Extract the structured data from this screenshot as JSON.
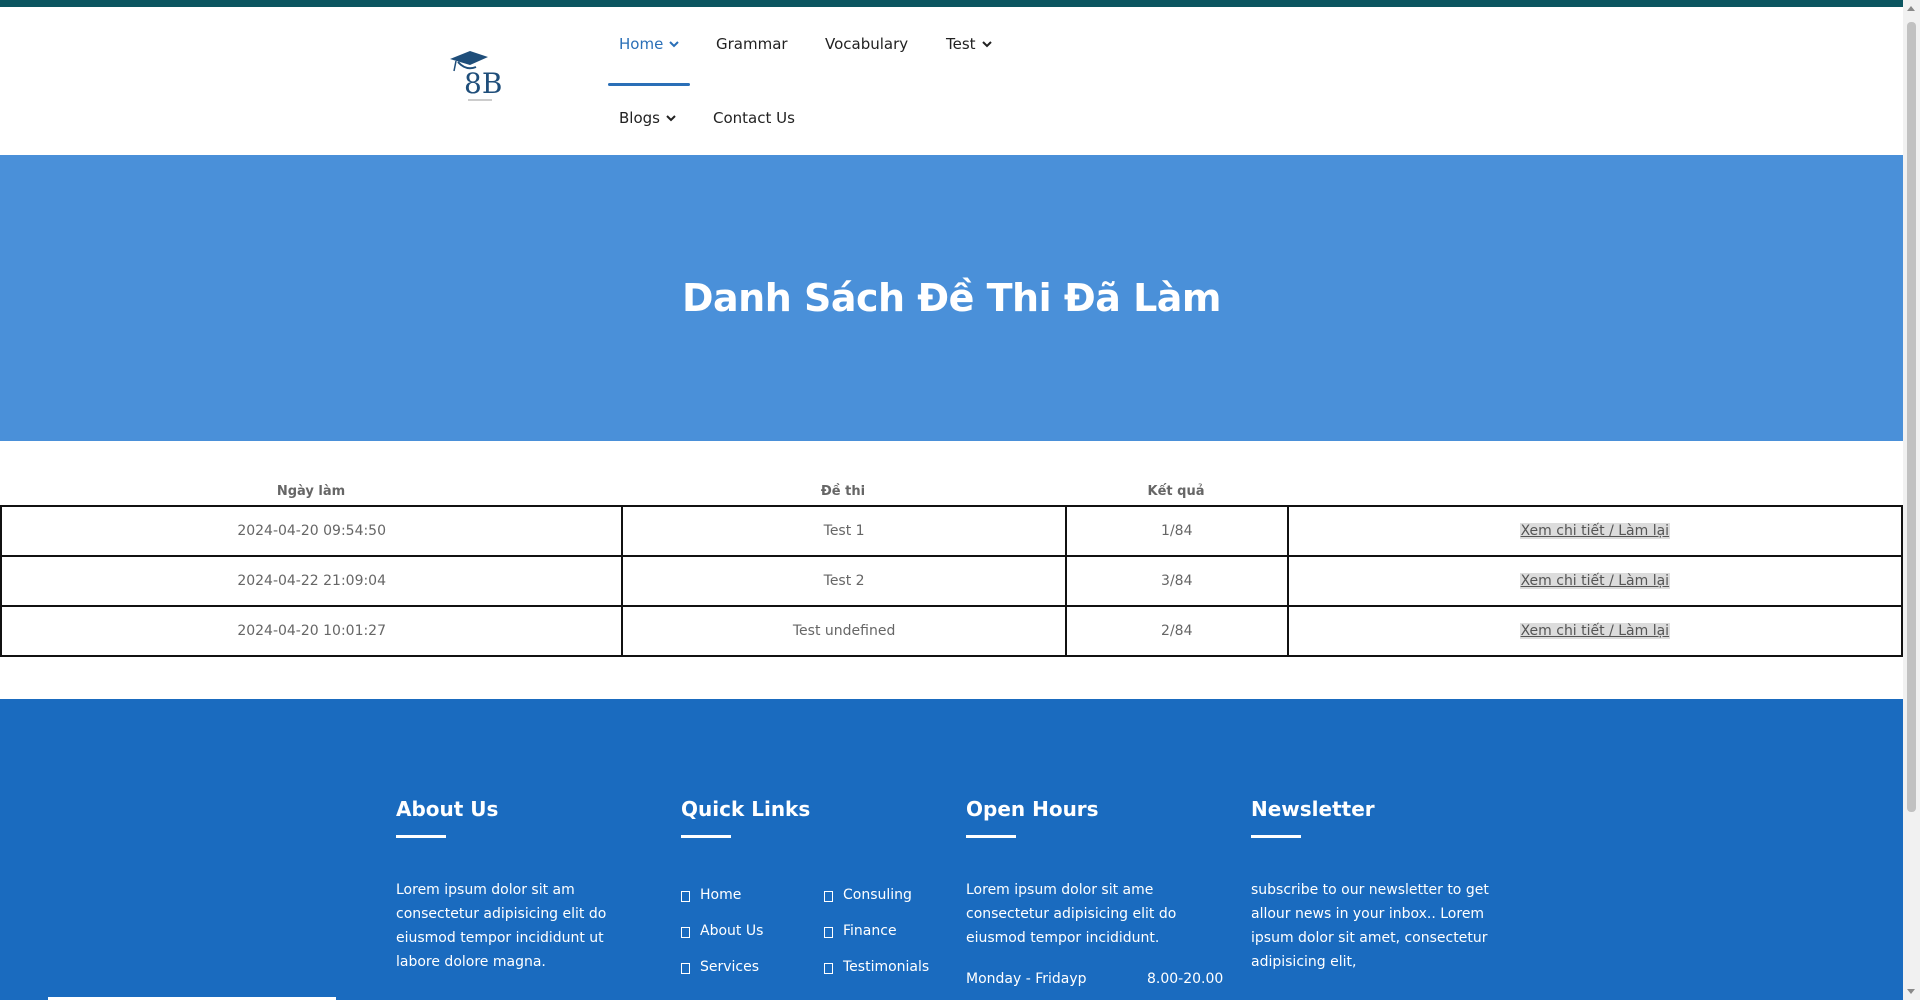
{
  "colors": {
    "top_strip": "#0b5560",
    "nav_active": "#2a6fb7",
    "hero_bg": "#4a90d9",
    "footer_bg": "#1a6bbf"
  },
  "logo": {
    "text": "8B",
    "icon": "graduation-cap-icon"
  },
  "nav": {
    "home": "Home",
    "grammar": "Grammar",
    "vocabulary": "Vocabulary",
    "test": "Test",
    "blogs": "Blogs",
    "contact": "Contact Us"
  },
  "hero": {
    "title": "Danh Sách Đề Thi Đã Làm"
  },
  "table": {
    "headers": [
      "Ngày làm",
      "Đề thi",
      "Kết quả"
    ],
    "rows": [
      {
        "date": "2024-04-20 09:54:50",
        "test": "Test 1",
        "score": "1/84",
        "action": "Xem chi tiết / Làm lại"
      },
      {
        "date": "2024-04-22 21:09:04",
        "test": "Test 2",
        "score": "3/84",
        "action": "Xem chi tiết / Làm lại"
      },
      {
        "date": "2024-04-20 10:01:27",
        "test": "Test undefined",
        "score": "2/84",
        "action": "Xem chi tiết / Làm lại"
      }
    ]
  },
  "footer": {
    "about": {
      "title": "About Us",
      "text": "Lorem ipsum dolor sit am consectetur adipisicing elit do eiusmod tempor incididunt ut labore dolore magna."
    },
    "quick_links": {
      "title": "Quick Links",
      "col1": [
        "Home",
        "About Us",
        "Services"
      ],
      "col2": [
        "Consuling",
        "Finance",
        "Testimonials"
      ]
    },
    "open_hours": {
      "title": "Open Hours",
      "text": "Lorem ipsum dolor sit ame consectetur adipisicing elit do eiusmod tempor incididunt.",
      "day": "Monday - Fridayp",
      "time": "8.00-20.00"
    },
    "newsletter": {
      "title": "Newsletter",
      "text": "subscribe to our newsletter to get allour news in your inbox.. Lorem ipsum dolor sit amet, consectetur adipisicing elit,"
    }
  }
}
